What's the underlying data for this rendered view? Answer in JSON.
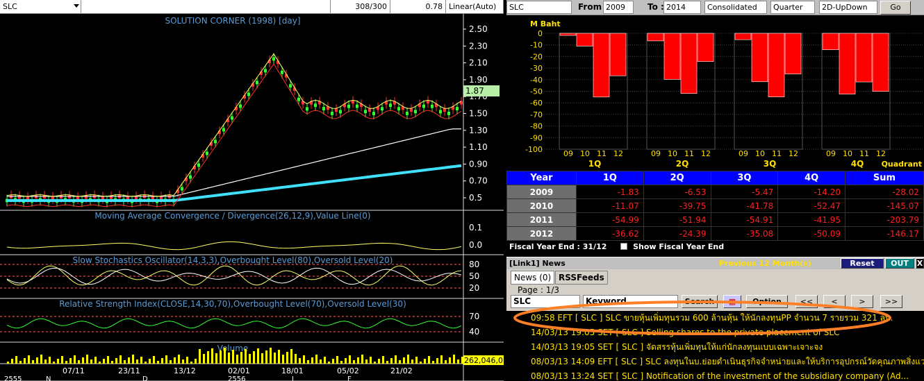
{
  "left_toolbar": {
    "symbol": "SLC",
    "count": "308/300",
    "value": "0.78",
    "scale": "Linear(Auto)"
  },
  "chart": {
    "title": "SOLUTION CORNER (1998) [day]",
    "price_ticks": [
      "2.50",
      "2.30",
      "2.10",
      "1.90",
      "1.70",
      "1.50",
      "1.30",
      "1.10",
      "0.90",
      "0.70",
      "0.5"
    ],
    "last_price": "1.87",
    "macd_title": "Moving Average Convergence / Divergence(26,12,9),Value Line(0)",
    "macd_ticks": [
      "0.1",
      "0.0"
    ],
    "stoch_title": "Slow Stochastics Oscillator(14,3,3),Overbought Level(80),Oversold Level(20)",
    "stoch_ticks": [
      "80",
      "50",
      "20"
    ],
    "rsi_title": "Relative Strength Index(CLOSE,14,30,70),Overbought Level(70),Oversold Level(30)",
    "rsi_ticks": [
      "70",
      "40"
    ],
    "volume_title": "Volume",
    "volume_value": "262,046,0",
    "date_labels": [
      "07/11",
      "23/11",
      "13/12",
      "02/01",
      "18/01",
      "05/02",
      "21/02"
    ],
    "axis_fragments": [
      "2555",
      "N",
      "D",
      "2556",
      "J",
      "F"
    ]
  },
  "right_toolbar": {
    "symbol": "SLC",
    "from_label": "From :",
    "from_value": "2009",
    "to_label": "To :",
    "to_value": "2014",
    "type": "Consolidated",
    "period": "Quarter",
    "view": "2D-UpDown",
    "go": "Go"
  },
  "quad_chart": {
    "unit": "M Baht",
    "quadrant_label": "Quadrant",
    "y_ticks": [
      "0",
      "-10",
      "-20",
      "-30",
      "-40",
      "-50",
      "-60",
      "-70",
      "-80",
      "-90",
      "-100"
    ],
    "groups": [
      {
        "label": "1Q",
        "years": [
          "09",
          "10",
          "11",
          "12"
        ],
        "values": [
          -1.83,
          -11.07,
          -54.99,
          -36.62
        ]
      },
      {
        "label": "2Q",
        "years": [
          "09",
          "10",
          "11",
          "12"
        ],
        "values": [
          -6.53,
          -39.75,
          -51.94,
          -24.39
        ]
      },
      {
        "label": "3Q",
        "years": [
          "09",
          "10",
          "11",
          "12"
        ],
        "values": [
          -5.47,
          -41.78,
          -54.91,
          -35.08
        ]
      },
      {
        "label": "4Q",
        "years": [
          "09",
          "10",
          "11",
          "12"
        ],
        "values": [
          -14.2,
          -52.47,
          -41.95,
          -50.09
        ]
      }
    ]
  },
  "table": {
    "headers": [
      "Year",
      "1Q",
      "2Q",
      "3Q",
      "4Q",
      "Sum"
    ],
    "rows": [
      [
        "2009",
        "-1.83",
        "-6.53",
        "-5.47",
        "-14.20",
        "-28.02"
      ],
      [
        "2010",
        "-11.07",
        "-39.75",
        "-41.78",
        "-52.47",
        "-145.07"
      ],
      [
        "2011",
        "-54.99",
        "-51.94",
        "-54.91",
        "-41.95",
        "-203.79"
      ],
      [
        "2012",
        "-36.62",
        "-24.39",
        "-35.08",
        "-50.09",
        "-146.17"
      ]
    ]
  },
  "fiscal": {
    "label": "Fiscal  Year  End  :  31/12",
    "checkbox_label": "Show Fiscal Year End"
  },
  "news": {
    "bar_label": "[Link1] News",
    "previous": "Previous 12 Month(s)",
    "reset": "Reset",
    "out": "OUT",
    "close": "X",
    "tabs": [
      "News (0)",
      "RSSFeeds"
    ],
    "page": "Page : 1/3",
    "symbol": "SLC",
    "keyword_label": "Keyword",
    "search": "Search",
    "option": "Option",
    "nav": [
      "<<",
      "<",
      ">",
      ">>"
    ],
    "items": [
      "09:58  EFT  [ SLC ]  SLC ขายหุ้นเพิ่มทุนรวม 600 ล้านหุ้น ให้นักลงทุนPP จำนวน 7 รายรวม 321 ลบ.",
      "14/03/13 19:05  SET  [ SLC ]  Selling shares to the private placement of SLC",
      "14/03/13 19:05  SET  [ SLC ]  จัดสรรหุ้นเพิ่มทุนให้แก่นักลงทุนแบบเฉพาะเจาะจง",
      "08/03/13 14:09  EFT  [ SLC ]  SLC ลงทุนในบ.ย่อยดำเนินธุรกิจจำหน่ายและให้บริการอุปกรณ์วัดคุณภาพสิ่งแวดล้อม",
      "08/03/13 13:24  SET  [ SLC ]  Notification of the investment of the subsidiary company (Ad..."
    ]
  },
  "colors": {
    "bar": "#ff0000",
    "tablehead": "#0000ff",
    "highlight": "#ff7f27",
    "ma_cyan": "#40e0ff"
  }
}
